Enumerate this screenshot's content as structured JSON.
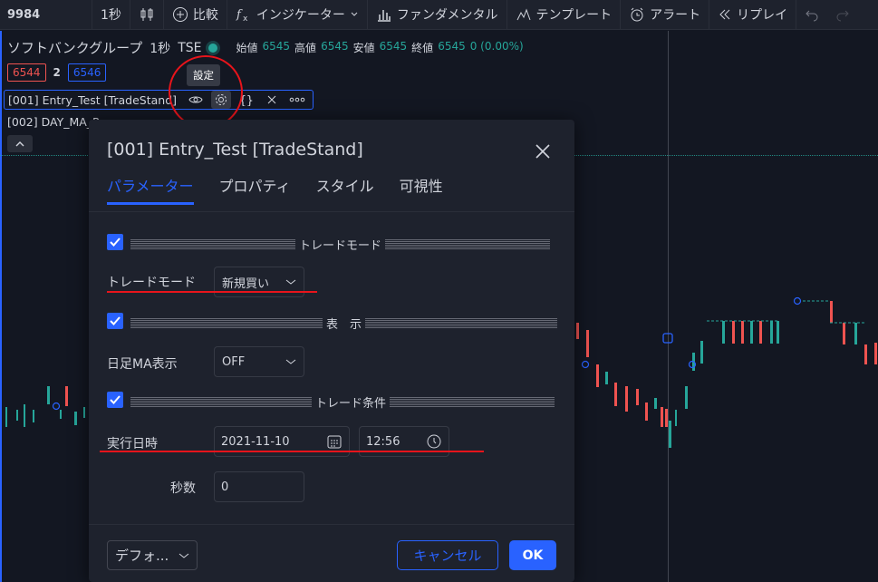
{
  "toolbar": {
    "symbol": "9984",
    "interval": "1秒",
    "compare": "比較",
    "indicators": "インジケーター",
    "fundamentals": "ファンダメンタル",
    "templates": "テンプレート",
    "alert": "アラート",
    "replay": "リプレイ"
  },
  "legend": {
    "name": "ソフトバンクグループ",
    "interval": "1秒",
    "exchange": "TSE",
    "open_label": "始値",
    "open": "6545",
    "high_label": "高値",
    "high": "6545",
    "low_label": "安値",
    "low": "6545",
    "close_label": "終値",
    "close": "6545",
    "change": "0 (0.00%)"
  },
  "prices": {
    "sell": "6544",
    "spread": "2",
    "buy": "6546"
  },
  "indicators": [
    {
      "name": "[001] Entry_Test [TradeStand]"
    },
    {
      "name": "[002] DAY_MA_P..."
    }
  ],
  "tooltip": "設定",
  "dialog": {
    "title": "[001] Entry_Test [TradeStand]",
    "tabs": [
      "パラメーター",
      "プロパティ",
      "スタイル",
      "可視性"
    ],
    "active_tab": 0,
    "sections": {
      "trade_mode_header": "トレードモード",
      "display_header": "表　示",
      "trade_condition_header": "トレード条件"
    },
    "fields": {
      "trade_mode_label": "トレードモード",
      "trade_mode_value": "新規買い",
      "daily_ma_label": "日足MA表示",
      "daily_ma_value": "OFF",
      "exec_datetime_label": "実行日時",
      "exec_date": "2021-11-10",
      "exec_time": "12:56",
      "seconds_label": "秒数",
      "seconds_value": "0"
    },
    "footer": {
      "defaults": "デフォ...",
      "cancel": "キャンセル",
      "ok": "OK"
    }
  },
  "colors": {
    "accent": "#2962ff",
    "up": "#26a69a",
    "down": "#ef5350",
    "annotation": "#e8141b"
  }
}
